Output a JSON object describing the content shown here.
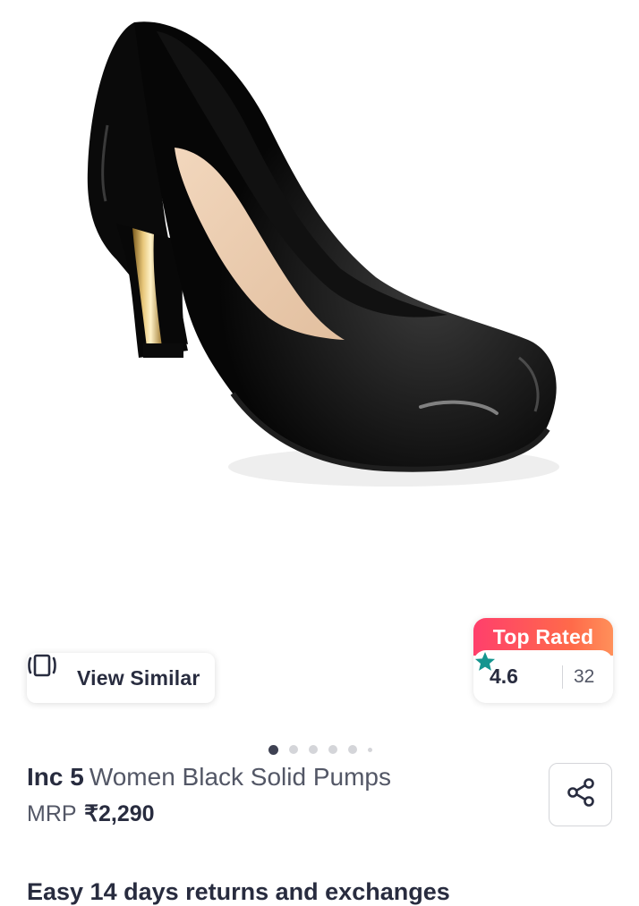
{
  "product": {
    "image_alt": "Inc 5 Women Black Solid Pumps",
    "brand": "Inc 5",
    "name": "Women Black Solid Pumps",
    "mrp_label": "MRP",
    "price": "₹2,290"
  },
  "view_similar": {
    "label": "View Similar",
    "icon": "view-similar-icon"
  },
  "rating": {
    "badge": "Top Rated",
    "value": "4.6",
    "count": "32",
    "star_color": "#14958f"
  },
  "carousel": {
    "total_dots": 6,
    "active_index": 0
  },
  "share": {
    "icon": "share-icon"
  },
  "returns": {
    "text": "Easy 14 days returns and exchanges"
  },
  "colors": {
    "brand_gradient_start": "#ff3f6c",
    "brand_gradient_end": "#ff905a",
    "text": "#282c3f"
  }
}
